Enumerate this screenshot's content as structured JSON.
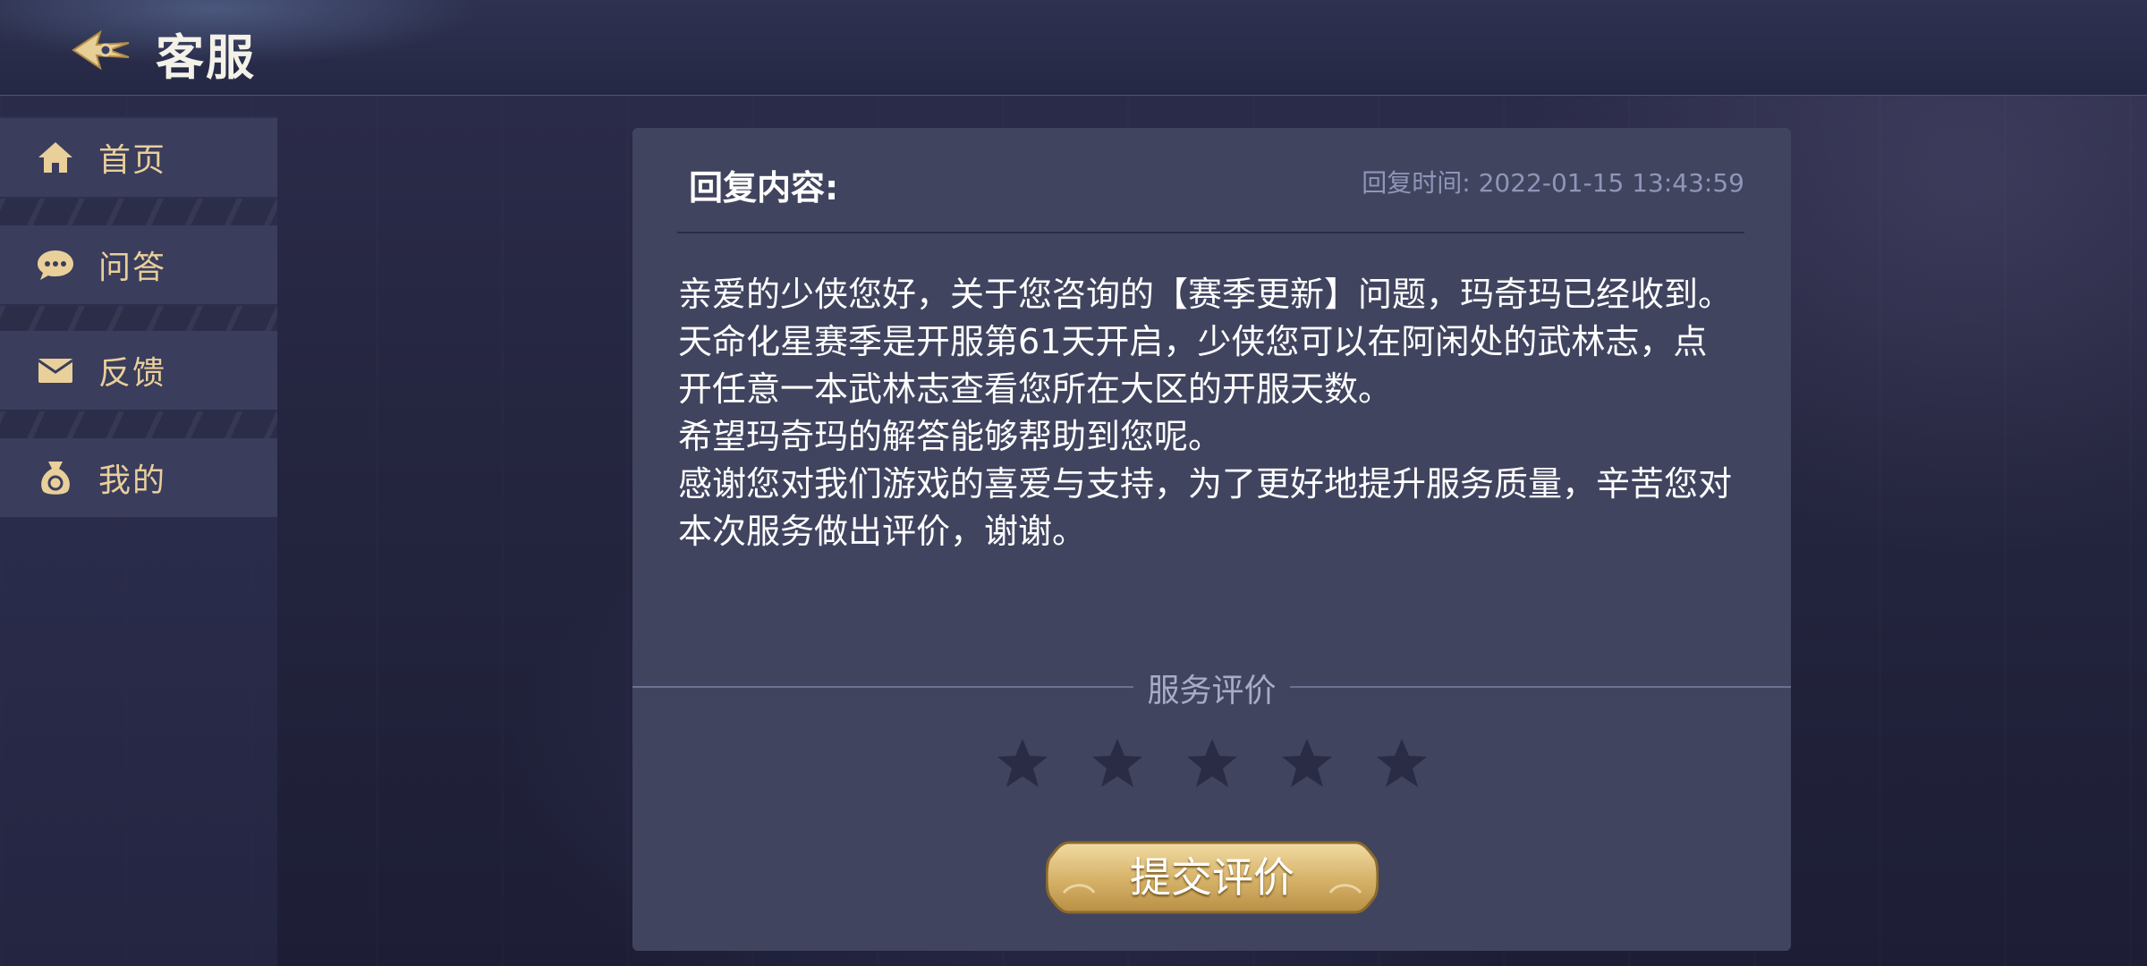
{
  "header": {
    "title": "客服",
    "back_icon": "ornate-back-arrow-icon"
  },
  "sidebar": {
    "items": [
      {
        "label": "首页",
        "icon": "home-icon"
      },
      {
        "label": "问答",
        "icon": "chat-bubble-icon"
      },
      {
        "label": "反馈",
        "icon": "mail-icon"
      },
      {
        "label": "我的",
        "icon": "money-bag-icon"
      }
    ]
  },
  "reply": {
    "heading": "回复内容:",
    "time": "回复时间: 2022-01-15 13:43:59",
    "paragraphs": [
      "亲爱的少侠您好，关于您咨询的【赛季更新】问题，玛奇玛已经收到。",
      "天命化星赛季是开服第61天开启，少侠您可以在阿闲处的武林志，点开任意一本武林志查看您所在大区的开服天数。",
      "希望玛奇玛的解答能够帮助到您呢。",
      "感谢您对我们游戏的喜爱与支持，为了更好地提升服务质量，辛苦您对本次服务做出评价，谢谢。"
    ]
  },
  "rating": {
    "label": "服务评价",
    "max_stars": 5,
    "selected_stars": 0,
    "star_color_empty": "#2a2c45"
  },
  "submit": {
    "label": "提交评价"
  },
  "colors": {
    "accent_gold": "#e9cf9a",
    "panel_bg": "#41445f",
    "time_text": "#8f96b8"
  }
}
